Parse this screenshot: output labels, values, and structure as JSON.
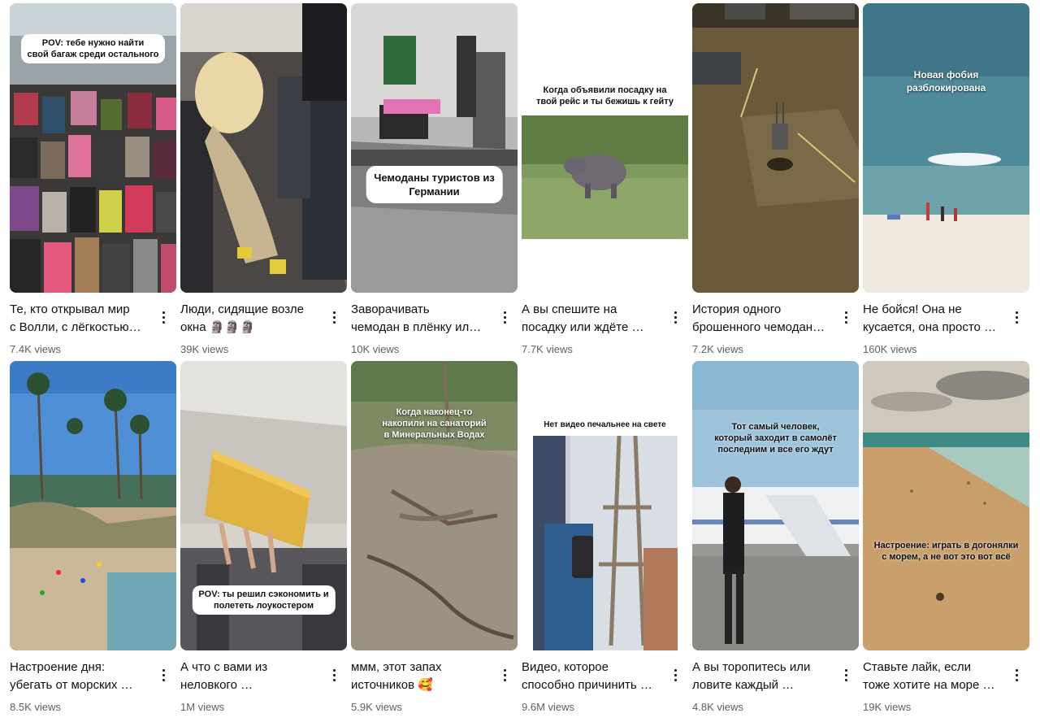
{
  "shorts": [
    {
      "title_lines": [
        "Те, кто открывал мир",
        "с Волли, с лёгкостью…"
      ],
      "views": "7.4K views",
      "overlay": "POV: тебе нужно найти\nсвой багаж среди остального"
    },
    {
      "title_lines": [
        "Люди, сидящие возле",
        "окна 🗿🗿🗿"
      ],
      "views": "39K views",
      "overlay": ""
    },
    {
      "title_lines": [
        "Заворачивать",
        "чемодан в плёнку ил…"
      ],
      "views": "10K views",
      "overlay": "Чемоданы туристов из\nГермании"
    },
    {
      "title_lines": [
        "А вы спешите на",
        "посадку или ждёте …"
      ],
      "views": "7.7K views",
      "overlay": "Когда объявили посадку на\nтвой рейс и ты бежишь к гейту"
    },
    {
      "title_lines": [
        "История одного",
        "брошенного чемодан…"
      ],
      "views": "7.2K views",
      "overlay": ""
    },
    {
      "title_lines": [
        "Не бойся! Она не",
        "кусается, она просто …"
      ],
      "views": "160K views",
      "overlay": "Новая фобия\nразблокирована"
    },
    {
      "title_lines": [
        "Настроение дня:",
        "убегать от морских …"
      ],
      "views": "8.5K views",
      "overlay": ""
    },
    {
      "title_lines": [
        "А что с вами из",
        "неловкого …"
      ],
      "views": "1M views",
      "overlay": "POV: ты решил сэкономить и\nполететь лоукостером"
    },
    {
      "title_lines": [
        "ммм, этот запах",
        "источников 🥰"
      ],
      "views": "5.9K views",
      "overlay": "Когда наконец-то\nнакопили на санаторий\nв Минеральных Водах"
    },
    {
      "title_lines": [
        "Видео, которое",
        "способно причинить …"
      ],
      "views": "9.6M views",
      "overlay": "Нет видео печальнее на свете"
    },
    {
      "title_lines": [
        "А вы торопитесь или",
        "ловите каждый …"
      ],
      "views": "4.8K views",
      "overlay": "Тот самый человек,\nкоторый заходит в самолёт\nпоследним и все его ждут"
    },
    {
      "title_lines": [
        "Ставьте лайк, если",
        "тоже хотите на море …"
      ],
      "views": "19K views",
      "overlay": "Настроение: играть в догонялки\nс морем, а не вот это вот всё"
    }
  ],
  "more_icon": "vertical-dots-icon"
}
